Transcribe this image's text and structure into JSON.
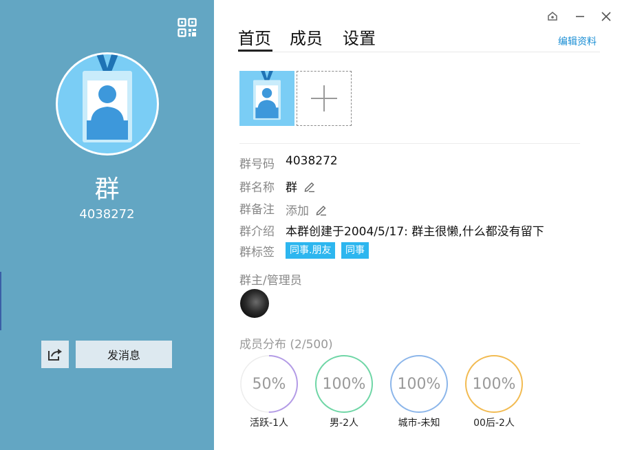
{
  "left_panel": {
    "group_name": "群",
    "group_number": "4038272",
    "send_message_label": "发消息"
  },
  "tabs": [
    {
      "label": "首页",
      "active": true
    },
    {
      "label": "成员",
      "active": false
    },
    {
      "label": "设置",
      "active": false
    }
  ],
  "edit_profile_label": "编辑资料",
  "info": {
    "number_label": "群号码",
    "number_value": "4038272",
    "name_label": "群名称",
    "name_value": "群",
    "remark_label": "群备注",
    "remark_value": "添加",
    "intro_label": "群介绍",
    "intro_value": "本群创建于2004/5/17:  群主很懒,什么都没有留下",
    "tags_label": "群标签",
    "tags": [
      "同事.朋友",
      "同事"
    ]
  },
  "admins_title": "群主/管理员",
  "distribution": {
    "title": "成员分布 (2/500)",
    "stats": [
      {
        "percent_text": "50%",
        "percent": 50,
        "label": "活跃-1人",
        "color": "#b39be6"
      },
      {
        "percent_text": "100%",
        "percent": 100,
        "label": "男-2人",
        "color": "#6fd6a6"
      },
      {
        "percent_text": "100%",
        "percent": 100,
        "label": "城市-未知",
        "color": "#8cb6ea"
      },
      {
        "percent_text": "100%",
        "percent": 100,
        "label": "00后-2人",
        "color": "#f2bb52"
      }
    ]
  },
  "colors": {
    "left_panel_bg": "#63a6c3",
    "accent_link": "#1a8ed4",
    "tag_bg": "#2db6ef",
    "avatar_bg": "#7acdf5"
  }
}
